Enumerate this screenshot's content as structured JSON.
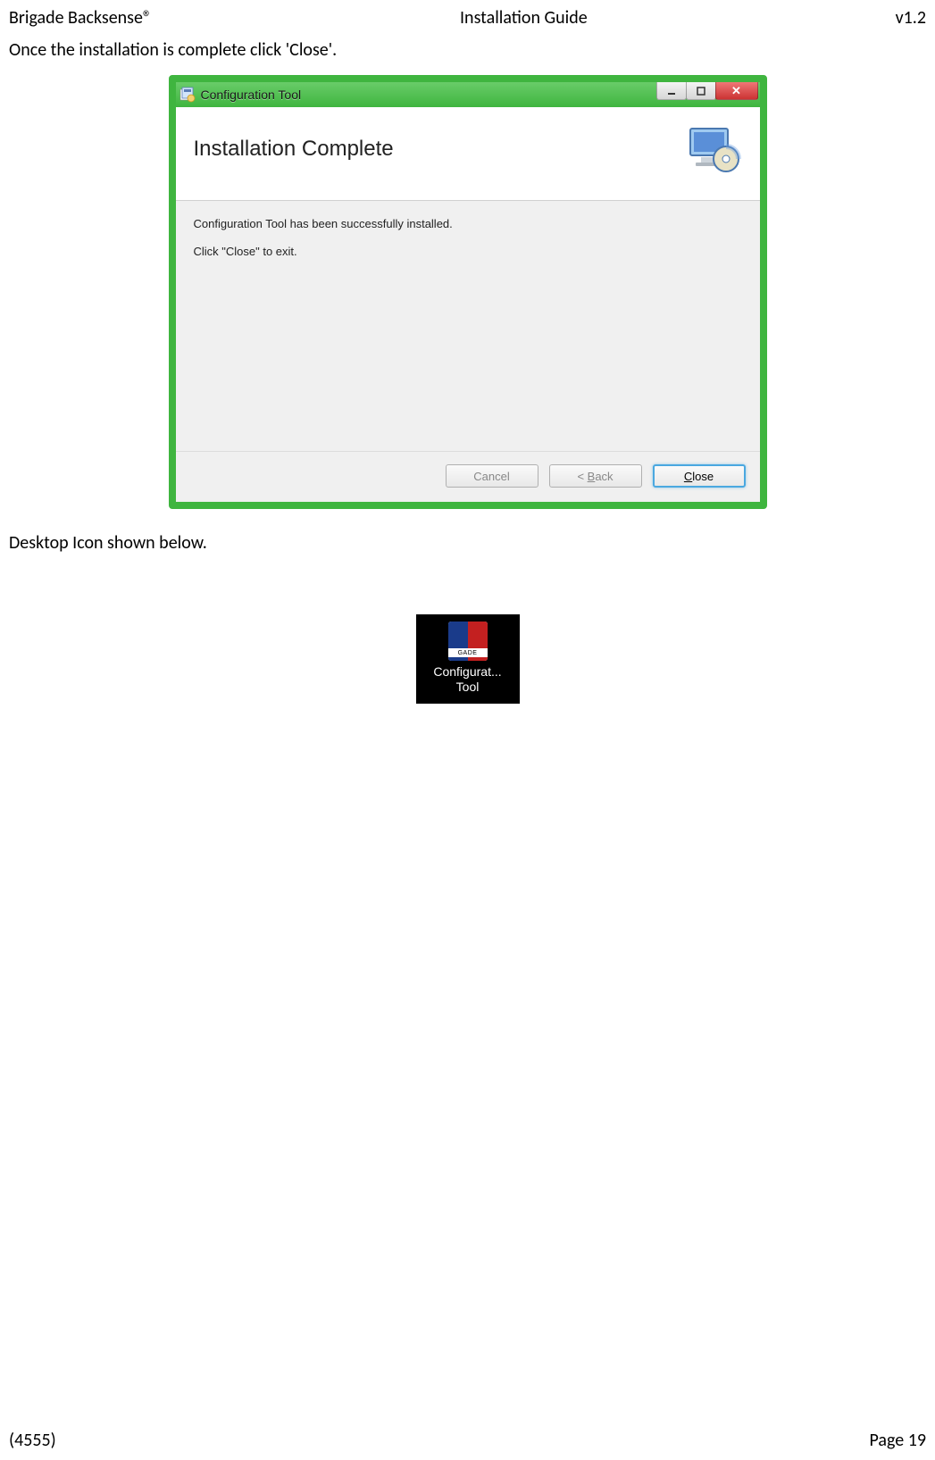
{
  "header": {
    "left": "Brigade Backsense®",
    "center": "Installation Guide",
    "right": "v1.2"
  },
  "body": {
    "intro1": "Once the installation is complete click 'Close'.",
    "intro2": "Desktop Icon shown below."
  },
  "installer": {
    "titlebar": "Configuration Tool",
    "banner_title": "Installation Complete",
    "content_line1": "Configuration Tool has been successfully installed.",
    "content_line2": "Click \"Close\" to exit.",
    "buttons": {
      "cancel": "Cancel",
      "back_prefix": "< ",
      "back_u": "B",
      "back_suffix": "ack",
      "close_u": "C",
      "close_suffix": "lose"
    }
  },
  "desktop_icon": {
    "label_line1": "Configurat...",
    "label_line2": "Tool",
    "brand": "GADE"
  },
  "footer": {
    "left": "(4555)",
    "right": "Page 19"
  }
}
